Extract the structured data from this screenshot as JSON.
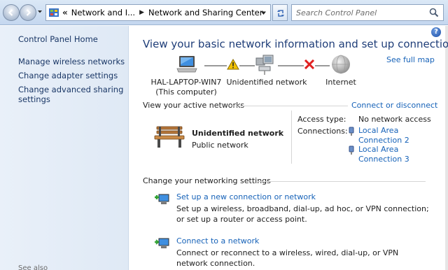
{
  "address_bar": {
    "breadcrumbs": [
      "Network and I...",
      "Network and Sharing Center"
    ],
    "search_placeholder": "Search Control Panel"
  },
  "left_pane": {
    "home": "Control Panel Home",
    "tasks": [
      {
        "label": "Manage wireless networks"
      },
      {
        "label": "Change adapter settings"
      },
      {
        "label": "Change advanced sharing settings"
      }
    ],
    "see_also": "See also"
  },
  "main": {
    "help": "?",
    "title": "View your basic network information and set up connections",
    "see_full_map": "See full map",
    "map": {
      "computer_name": "HAL-LAPTOP-WIN7",
      "computer_sub": "(This computer)",
      "middle": "Unidentified network",
      "internet": "Internet",
      "warning_color": "#f2c200",
      "error_color": "#e02020"
    },
    "active_networks": {
      "header": "View your active networks",
      "connect_link": "Connect or disconnect",
      "network_name": "Unidentified network",
      "network_type": "Public network",
      "access_type_label": "Access type:",
      "access_type_value": "No network access",
      "connections_label": "Connections:",
      "connections": [
        {
          "line1": "Local Area",
          "line2": "Connection 2"
        },
        {
          "line1": "Local Area",
          "line2": "Connection 3"
        }
      ]
    },
    "change_settings": {
      "header": "Change your networking settings",
      "items": [
        {
          "link": "Set up a new connection or network",
          "desc": "Set up a wireless, broadband, dial-up, ad hoc, or VPN connection; or set up a router or access point."
        },
        {
          "link": "Connect to a network",
          "desc": "Connect or reconnect to a wireless, wired, dial-up, or VPN network connection."
        }
      ]
    }
  }
}
